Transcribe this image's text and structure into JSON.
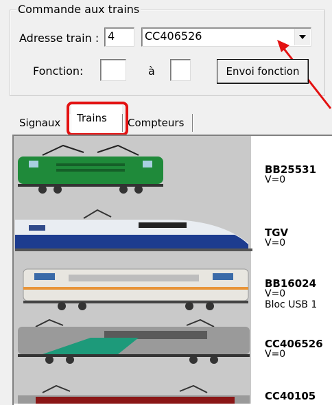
{
  "group": {
    "title": "Commande aux trains"
  },
  "address": {
    "label": "Adresse train :",
    "value": "4"
  },
  "train_select": {
    "selected": "CC406526"
  },
  "function": {
    "label": "Fonction:",
    "from_value": "",
    "to_label": "à",
    "to_value": "",
    "send_label": "Envoi fonction"
  },
  "tabs": [
    {
      "label": "Signaux"
    },
    {
      "label": "Trains",
      "active": true
    },
    {
      "label": "Compteurs"
    }
  ],
  "trains": [
    {
      "name": "BB25531",
      "speed": "V=0",
      "extra": ""
    },
    {
      "name": "TGV",
      "speed": "V=0",
      "extra": ""
    },
    {
      "name": "BB16024",
      "speed": "V=0",
      "extra": "Bloc USB 1"
    },
    {
      "name": "CC406526",
      "speed": "V=0",
      "extra": ""
    },
    {
      "name": "CC40105",
      "speed": "",
      "extra": ""
    }
  ],
  "colors": {
    "highlight": "#e31111",
    "panel": "#c9c9c9"
  }
}
